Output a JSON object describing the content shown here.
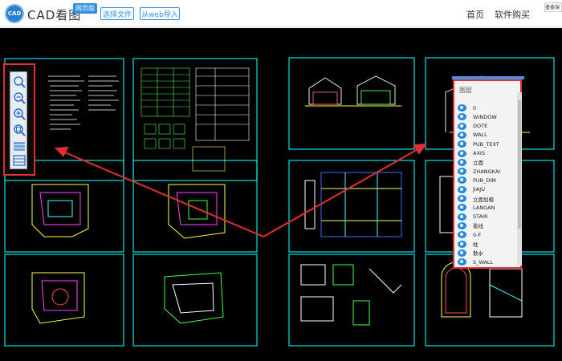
{
  "header": {
    "logo_text": "CAD",
    "app_title": "CAD看图",
    "badge": "网页版",
    "select_file": "选择文件",
    "web_import": "从web导入",
    "nav_home": "首页",
    "nav_buy": "软件购买",
    "nav_more": "软",
    "mini_tab": "墨香端"
  },
  "zoom_tools": [
    "zoom-window-icon",
    "zoom-out-icon",
    "zoom-in-icon",
    "zoom-extents-icon",
    "layers-icon",
    "layout-icon"
  ],
  "layer_panel": {
    "title": "图层",
    "layers": [
      "0",
      "WINDOW",
      "DOTE",
      "WALL",
      "PUB_TEXT",
      "AXIS",
      "立面",
      "ZHANGKAI",
      "PUB_DIM",
      "JIAJU",
      "立面加粗",
      "LANGAN",
      "STAIR",
      "看线",
      "0-F",
      "柱",
      "散水",
      "S_WALL"
    ]
  },
  "colors": {
    "accent": "#2f8fe6",
    "highlight": "#e23030",
    "frame": "#00e5e5",
    "canvas": "#000000"
  }
}
